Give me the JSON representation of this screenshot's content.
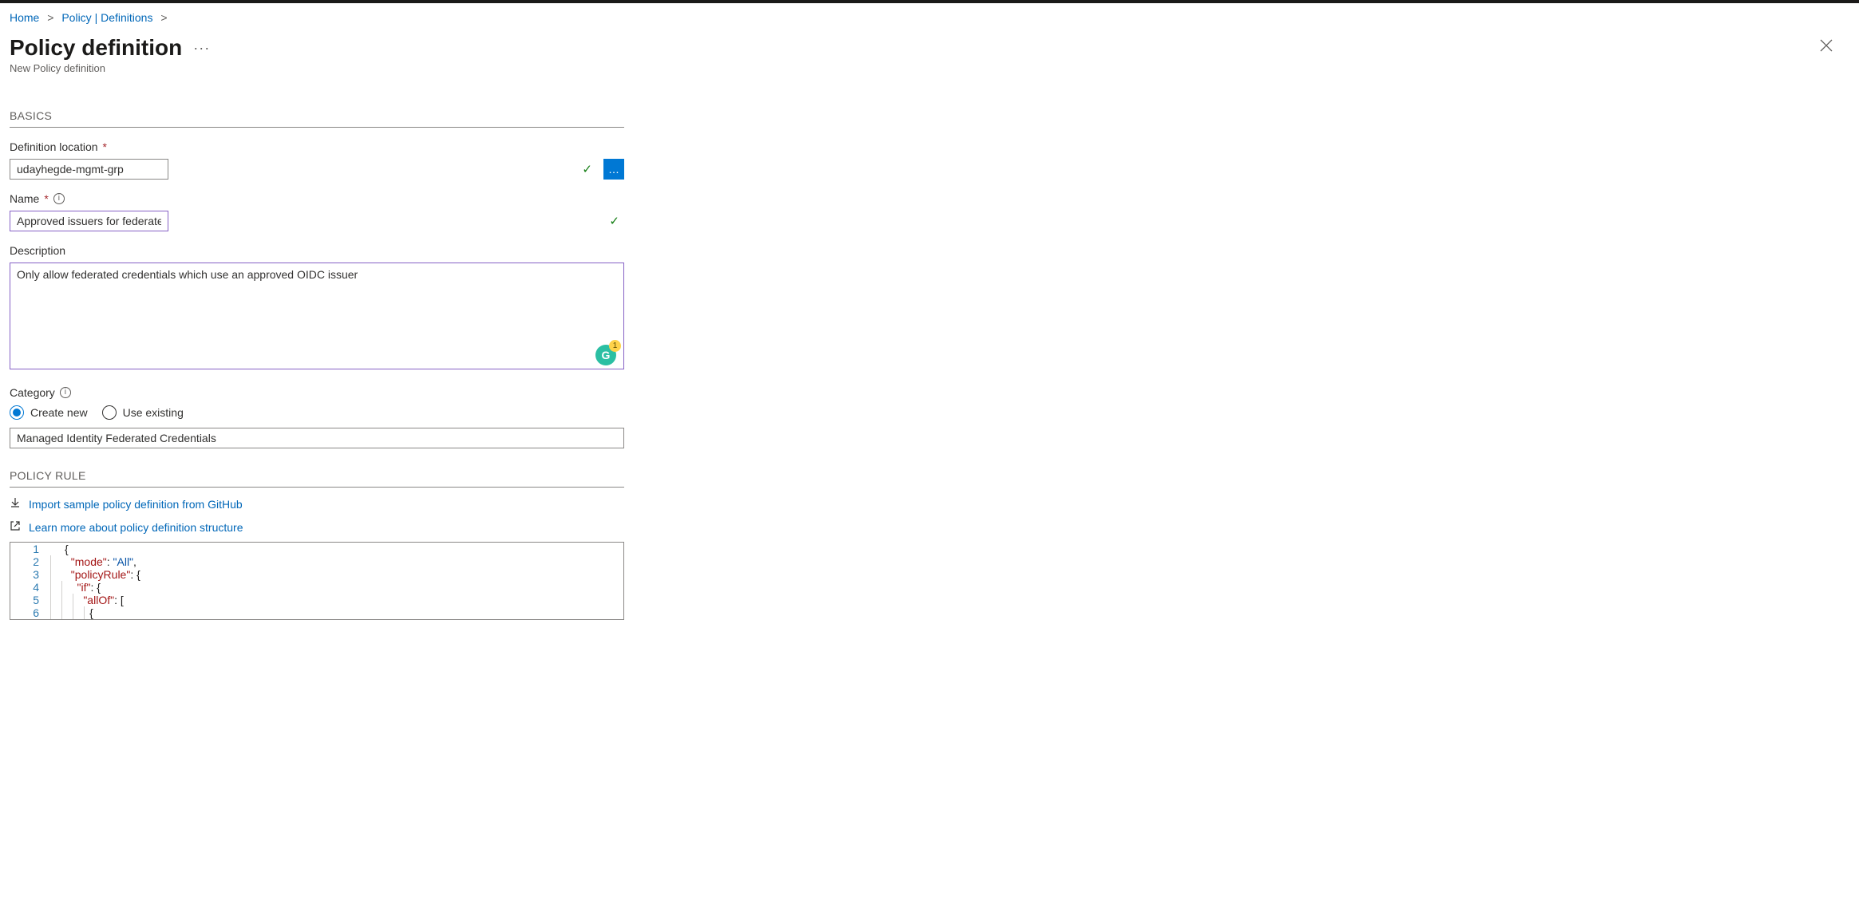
{
  "breadcrumbs": {
    "home": "Home",
    "policy": "Policy | Definitions"
  },
  "header": {
    "title": "Policy definition",
    "subtitle": "New Policy definition"
  },
  "sections": {
    "basics": "BASICS",
    "policy_rule": "POLICY RULE"
  },
  "labels": {
    "definition_location": "Definition location",
    "name": "Name",
    "description": "Description",
    "category": "Category",
    "create_new": "Create new",
    "use_existing": "Use existing"
  },
  "values": {
    "definition_location": "udayhegde-mgmt-grp",
    "name": "Approved issuers for federated credentials",
    "description": "Only allow federated credentials which use an approved OIDC issuer",
    "category": "Managed Identity Federated Credentials"
  },
  "grammarly": {
    "letter": "G",
    "count": "1"
  },
  "links": {
    "import": "Import sample policy definition from GitHub",
    "learn": "Learn more about policy definition structure"
  },
  "code": {
    "l1": "{",
    "l2a": "  \"mode\"",
    "l2b": ": ",
    "l2c": "\"All\"",
    "l2d": ",",
    "l3a": "  \"policyRule\"",
    "l3b": ": {",
    "l4a": "    \"if\"",
    "l4b": ": {",
    "l5a": "      \"allOf\"",
    "l5b": ": [",
    "l6": "        {"
  }
}
